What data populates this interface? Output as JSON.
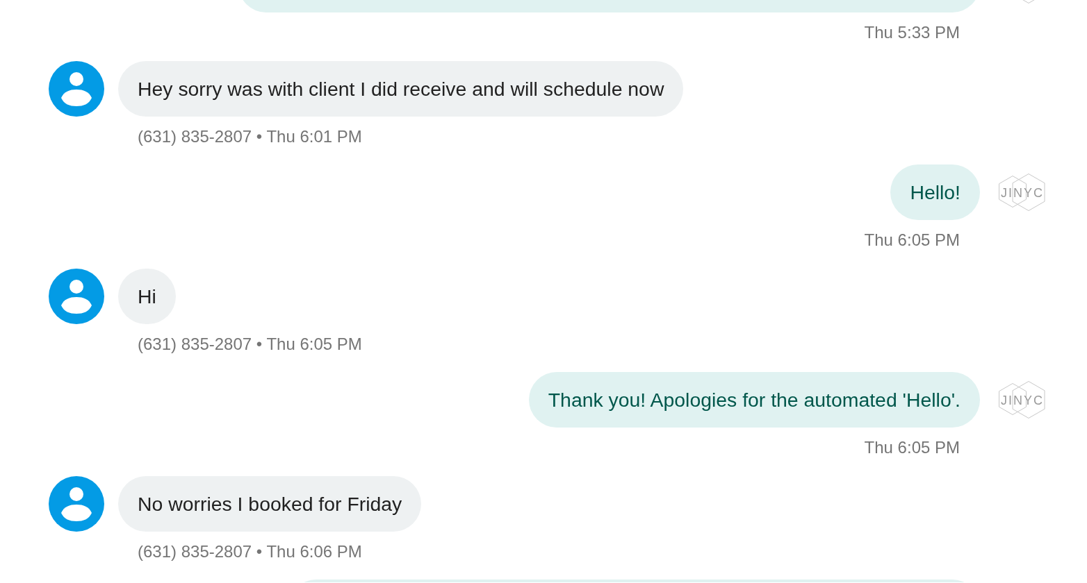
{
  "messages": [
    {
      "kind": "outgoing",
      "logo": true,
      "meta": "Thu 5:33 PM"
    },
    {
      "kind": "incoming",
      "text": "Hey sorry was with client I did receive and will schedule now",
      "meta": "(631) 835-2807 • Thu 6:01 PM"
    },
    {
      "kind": "outgoing",
      "text": "Hello!",
      "logo": true,
      "logo_text": "JINYC",
      "meta": "Thu 6:05 PM"
    },
    {
      "kind": "incoming",
      "text": "Hi",
      "meta": "(631) 835-2807 • Thu 6:05 PM"
    },
    {
      "kind": "outgoing",
      "text": "Thank you! Apologies for the automated 'Hello'.",
      "logo": true,
      "logo_text": "JINYC",
      "meta": "Thu 6:05 PM"
    },
    {
      "kind": "incoming",
      "text": "No worries I booked for Friday",
      "meta": "(631) 835-2807 • Thu 6:06 PM"
    },
    {
      "kind": "outgoing",
      "logo": false
    }
  ]
}
